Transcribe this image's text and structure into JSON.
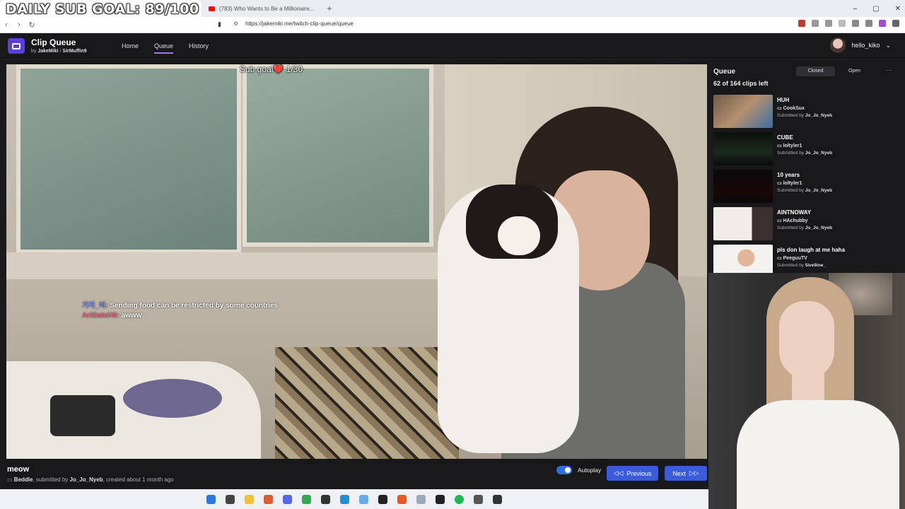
{
  "overlay": {
    "daily_goal": "DAILY SUB GOAL: 89/100"
  },
  "browser": {
    "tab_active_close": "✕",
    "tab_other": "(783) Who Wants to Be a Millionaire...",
    "tab_plus": "+",
    "url": "https://jakemiki.me/twitch-clip-queue/queue",
    "window_controls": [
      "–",
      "▢",
      "✕"
    ]
  },
  "app": {
    "brand": "Clip Queue",
    "by_prefix": "by",
    "author1": "JakeMiki",
    "separator": "/",
    "author2": "SirMuffin9",
    "nav": [
      "Home",
      "Queue",
      "History"
    ],
    "nav_active": "Queue",
    "username": "hello_kiko"
  },
  "video": {
    "sub_goal": "Sub goal❤️ 1/30",
    "chat": [
      {
        "user": "가자_비:",
        "text": "Sending food can be restricted by some countries"
      },
      {
        "user": "AriGatoH0:",
        "text": "awww"
      }
    ]
  },
  "clip": {
    "title": "meow",
    "channel": "Beddle",
    "submitted_prefix": ", submitted by",
    "submitter": "Jo_Jo_Nyeb",
    "created": ", created about 1 month ago",
    "autoplay_label": "Autoplay",
    "prev_label": "Previous",
    "next_label": "Next"
  },
  "queue": {
    "title": "Queue",
    "tabs": [
      "Closed",
      "Open"
    ],
    "active_tab": "Closed",
    "more": "···",
    "count": "62 of 164 clips left",
    "submitted_prefix": "Submitted by",
    "items": [
      {
        "title": "HUH",
        "channel": "CookSux",
        "submitter": "Jo_Jo_Nyeb",
        "thumb_color": "#8a6f5a"
      },
      {
        "title": "CUBE",
        "channel": "loltyler1",
        "submitter": "Jo_Jo_Nyeb",
        "thumb_color": "#101612"
      },
      {
        "title": "10 years",
        "channel": "loltyler1",
        "submitter": "Jo_Jo_Nyeb",
        "thumb_color": "#0d0d10"
      },
      {
        "title": "AINTNOWAY",
        "channel": "HAchubby",
        "submitter": "Jo_Jo_Nyeb",
        "thumb_color": "#d9cfc8"
      },
      {
        "title": "pls don laugh at me haha",
        "channel": "PeeguuTV",
        "submitter": "5ive9ine_",
        "thumb_color": "#d8c3b0"
      }
    ]
  }
}
